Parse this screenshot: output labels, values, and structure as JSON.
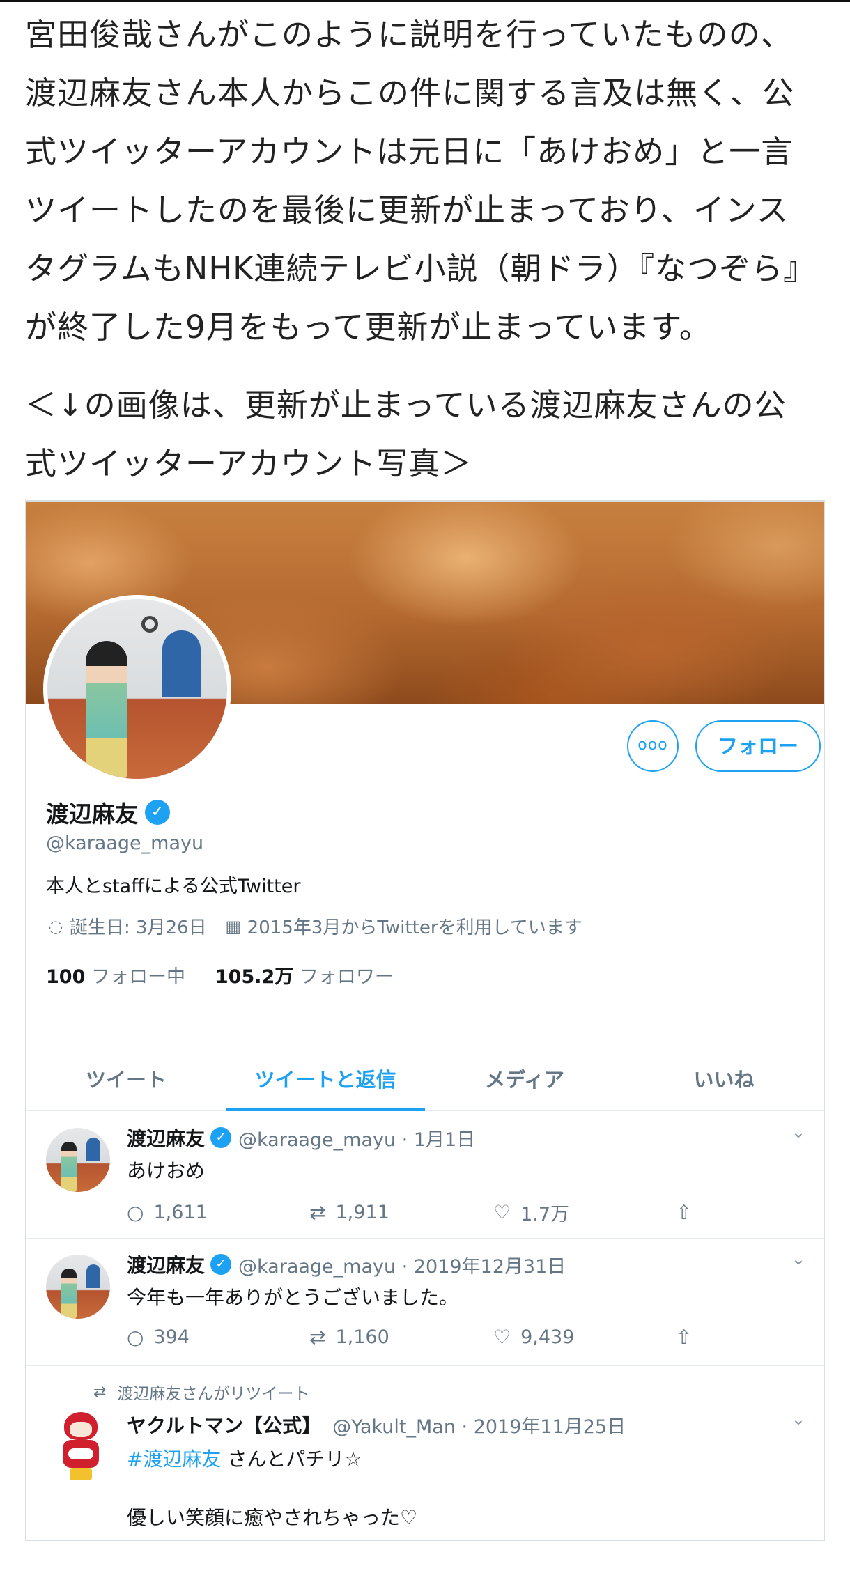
{
  "article": {
    "paragraph1": [
      "宮田俊哉さんがこのように説明を行っていたものの、",
      "渡辺麻友さん本人からこの件に関する言及は無く、公",
      "式ツイッターアカウントは元日に「あけおめ」と一言",
      "ツイートしたのを最後に更新が止まっており、インス",
      "タグラムもNHK連続テレビ小説（朝ドラ）『なつぞら』",
      "が終了した9月をもって更新が止まっています。"
    ],
    "paragraph2": [
      "＜↓の画像は、更新が止まっている渡辺麻友さんの公",
      "式ツイッターアカウント写真＞"
    ]
  },
  "profile": {
    "more_label": "ooo",
    "follow_label": "フォロー",
    "name": "渡辺麻友",
    "verified_mark": "✓",
    "handle": "@karaage_mayu",
    "bio": "本人とstaffによる公式Twitter",
    "birthday": "誕生日: 3月26日",
    "joined": "2015年3月からTwitterを利用しています",
    "following_count": "100",
    "following_label": "フォロー中",
    "followers_count": "105.2万",
    "followers_label": "フォロワー"
  },
  "tabs": [
    {
      "label": "ツイート",
      "active": false
    },
    {
      "label": "ツイートと返信",
      "active": true
    },
    {
      "label": "メディア",
      "active": false
    },
    {
      "label": "いいね",
      "active": false
    }
  ],
  "tweets": [
    {
      "name": "渡辺麻友",
      "meta": "@karaage_mayu · 1月1日",
      "text": "あけおめ",
      "replies": "1,611",
      "retweets": "1,911",
      "likes": "1.7万"
    },
    {
      "name": "渡辺麻友",
      "meta": "@karaage_mayu · 2019年12月31日",
      "text": "今年も一年ありがとうございました。",
      "replies": "394",
      "retweets": "1,160",
      "likes": "9,439"
    },
    {
      "retweet_label": "渡辺麻友さんがリツイート",
      "name": "ヤクルトマン【公式】",
      "meta": "@Yakult_Man · 2019年11月25日",
      "hashtag": "#渡辺麻友",
      "text_rest": " さんとパチリ☆",
      "text2": "優しい笑顔に癒やされちゃった♡"
    }
  ],
  "icons": {
    "reply": "○",
    "retweet": "⇄",
    "like": "♡",
    "share": "⇧",
    "chevron": "⌄",
    "location": "◌",
    "calendar": "▦"
  },
  "colors": {
    "accent": "#1da1f2",
    "secondary_text": "#657786",
    "primary_text": "#14171a"
  }
}
